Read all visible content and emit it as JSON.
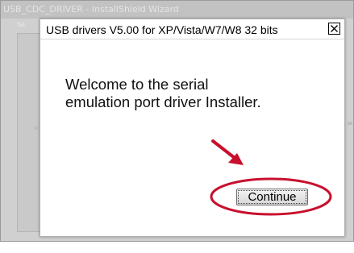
{
  "background_window": {
    "title": "USB_CDC_DRIVER - InstallShield Wizard",
    "subtitle": "Se"
  },
  "dialog": {
    "title": "USB drivers V5.00 for XP/Vista/W7/W8 32 bits",
    "close_icon": "close-icon",
    "welcome_line1": "Welcome to the serial",
    "welcome_line2": "emulation port driver Installer.",
    "continue_label": "Continue"
  },
  "annotation": {
    "arrow_icon": "arrow-down-right-icon",
    "highlight": "ellipse-highlight",
    "color": "#c8102e"
  }
}
